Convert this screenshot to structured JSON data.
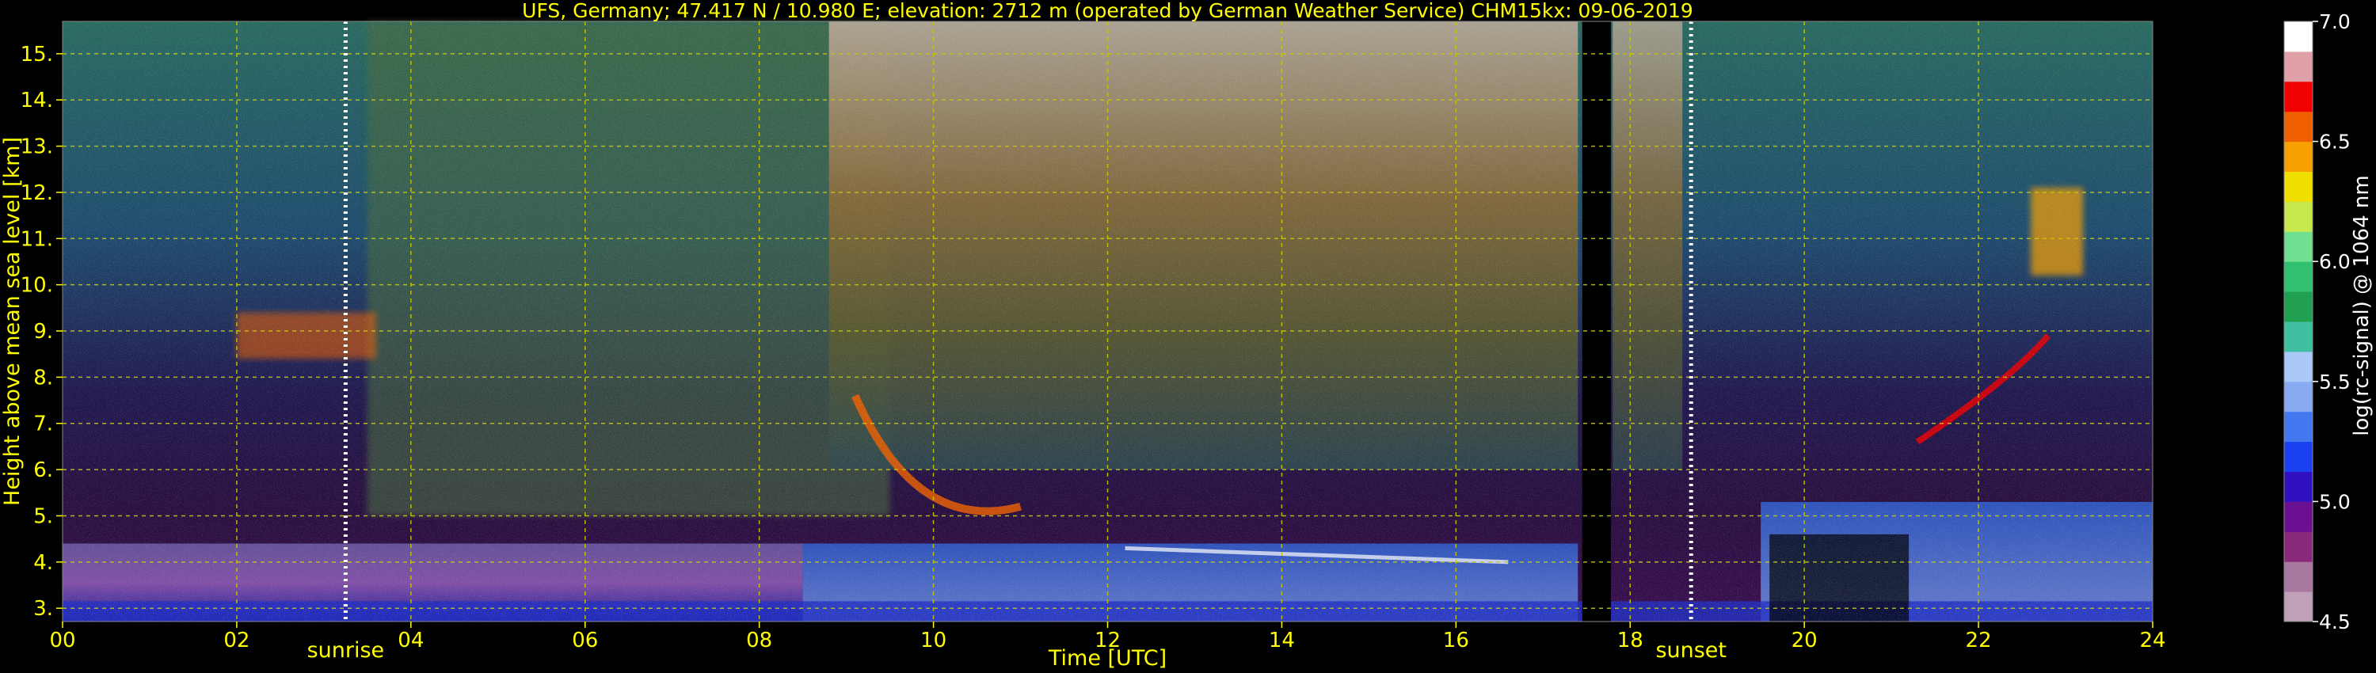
{
  "chart_data": {
    "type": "heatmap",
    "title": "UFS, Germany; 47.417 N / 10.980 E; elevation: 2712 m  (operated by German Weather Service)    CHM15kx: 09-06-2019",
    "xlabel": "Time [UTC]",
    "ylabel": "Height above mean sea level [km]",
    "colorbar_label": "log(rc-signal) @ 1064 nm",
    "xlim": [
      0,
      24
    ],
    "ylim": [
      2.712,
      15.7
    ],
    "clim": [
      4.5,
      7.0
    ],
    "x_ticks": [
      0,
      2,
      4,
      6,
      8,
      10,
      12,
      14,
      16,
      18,
      20,
      22,
      24
    ],
    "x_tick_labels": [
      "00",
      "02",
      "04",
      "06",
      "08",
      "10",
      "12",
      "14",
      "16",
      "18",
      "20",
      "22",
      "24"
    ],
    "y_ticks": [
      3,
      4,
      5,
      6,
      7,
      8,
      9,
      10,
      11,
      12,
      13,
      14,
      15
    ],
    "y_tick_labels": [
      "3.",
      "4.",
      "5.",
      "6.",
      "7.",
      "8.",
      "9.",
      "10.",
      "11.",
      "12.",
      "13.",
      "14.",
      "15."
    ],
    "colorbar_ticks": [
      4.5,
      5.0,
      5.5,
      6.0,
      6.5,
      7.0
    ],
    "colorbar_tick_labels": [
      "4.5",
      "5.0",
      "5.5",
      "6.0",
      "6.5",
      "7.0"
    ],
    "grid": true,
    "annotations": [
      {
        "label": "sunrise",
        "x": 3.25
      },
      {
        "label": "sunset",
        "x": 18.7
      }
    ],
    "no_data_intervals": [
      [
        17.45,
        17.78
      ]
    ],
    "colors": {
      "background": "#000000",
      "text": "#ffff00",
      "grid": "#c8c800",
      "marker_lines": "#ffffff",
      "colorbar": [
        "#c0a0b8",
        "#a878a0",
        "#8a2a7a",
        "#6a1090",
        "#3010c0",
        "#1a40f0",
        "#4478f0",
        "#88aaf0",
        "#aac8f8",
        "#40c0a0",
        "#20a050",
        "#30c070",
        "#70e090",
        "#c8e850",
        "#f0e000",
        "#f8a000",
        "#f06000",
        "#f00000",
        "#e0a0a8",
        "#ffffff"
      ]
    }
  }
}
